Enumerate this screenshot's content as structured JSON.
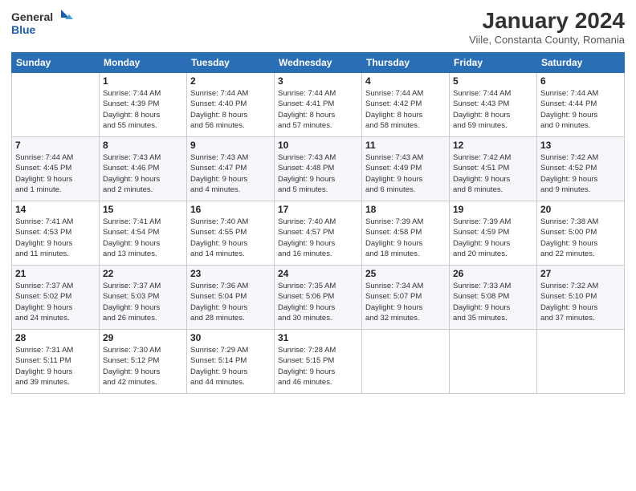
{
  "logo": {
    "general": "General",
    "blue": "Blue"
  },
  "header": {
    "title": "January 2024",
    "location": "Viile, Constanta County, Romania"
  },
  "weekdays": [
    "Sunday",
    "Monday",
    "Tuesday",
    "Wednesday",
    "Thursday",
    "Friday",
    "Saturday"
  ],
  "weeks": [
    [
      {
        "day": "",
        "info": ""
      },
      {
        "day": "1",
        "info": "Sunrise: 7:44 AM\nSunset: 4:39 PM\nDaylight: 8 hours\nand 55 minutes."
      },
      {
        "day": "2",
        "info": "Sunrise: 7:44 AM\nSunset: 4:40 PM\nDaylight: 8 hours\nand 56 minutes."
      },
      {
        "day": "3",
        "info": "Sunrise: 7:44 AM\nSunset: 4:41 PM\nDaylight: 8 hours\nand 57 minutes."
      },
      {
        "day": "4",
        "info": "Sunrise: 7:44 AM\nSunset: 4:42 PM\nDaylight: 8 hours\nand 58 minutes."
      },
      {
        "day": "5",
        "info": "Sunrise: 7:44 AM\nSunset: 4:43 PM\nDaylight: 8 hours\nand 59 minutes."
      },
      {
        "day": "6",
        "info": "Sunrise: 7:44 AM\nSunset: 4:44 PM\nDaylight: 9 hours\nand 0 minutes."
      }
    ],
    [
      {
        "day": "7",
        "info": "Sunrise: 7:44 AM\nSunset: 4:45 PM\nDaylight: 9 hours\nand 1 minute."
      },
      {
        "day": "8",
        "info": "Sunrise: 7:43 AM\nSunset: 4:46 PM\nDaylight: 9 hours\nand 2 minutes."
      },
      {
        "day": "9",
        "info": "Sunrise: 7:43 AM\nSunset: 4:47 PM\nDaylight: 9 hours\nand 4 minutes."
      },
      {
        "day": "10",
        "info": "Sunrise: 7:43 AM\nSunset: 4:48 PM\nDaylight: 9 hours\nand 5 minutes."
      },
      {
        "day": "11",
        "info": "Sunrise: 7:43 AM\nSunset: 4:49 PM\nDaylight: 9 hours\nand 6 minutes."
      },
      {
        "day": "12",
        "info": "Sunrise: 7:42 AM\nSunset: 4:51 PM\nDaylight: 9 hours\nand 8 minutes."
      },
      {
        "day": "13",
        "info": "Sunrise: 7:42 AM\nSunset: 4:52 PM\nDaylight: 9 hours\nand 9 minutes."
      }
    ],
    [
      {
        "day": "14",
        "info": "Sunrise: 7:41 AM\nSunset: 4:53 PM\nDaylight: 9 hours\nand 11 minutes."
      },
      {
        "day": "15",
        "info": "Sunrise: 7:41 AM\nSunset: 4:54 PM\nDaylight: 9 hours\nand 13 minutes."
      },
      {
        "day": "16",
        "info": "Sunrise: 7:40 AM\nSunset: 4:55 PM\nDaylight: 9 hours\nand 14 minutes."
      },
      {
        "day": "17",
        "info": "Sunrise: 7:40 AM\nSunset: 4:57 PM\nDaylight: 9 hours\nand 16 minutes."
      },
      {
        "day": "18",
        "info": "Sunrise: 7:39 AM\nSunset: 4:58 PM\nDaylight: 9 hours\nand 18 minutes."
      },
      {
        "day": "19",
        "info": "Sunrise: 7:39 AM\nSunset: 4:59 PM\nDaylight: 9 hours\nand 20 minutes."
      },
      {
        "day": "20",
        "info": "Sunrise: 7:38 AM\nSunset: 5:00 PM\nDaylight: 9 hours\nand 22 minutes."
      }
    ],
    [
      {
        "day": "21",
        "info": "Sunrise: 7:37 AM\nSunset: 5:02 PM\nDaylight: 9 hours\nand 24 minutes."
      },
      {
        "day": "22",
        "info": "Sunrise: 7:37 AM\nSunset: 5:03 PM\nDaylight: 9 hours\nand 26 minutes."
      },
      {
        "day": "23",
        "info": "Sunrise: 7:36 AM\nSunset: 5:04 PM\nDaylight: 9 hours\nand 28 minutes."
      },
      {
        "day": "24",
        "info": "Sunrise: 7:35 AM\nSunset: 5:06 PM\nDaylight: 9 hours\nand 30 minutes."
      },
      {
        "day": "25",
        "info": "Sunrise: 7:34 AM\nSunset: 5:07 PM\nDaylight: 9 hours\nand 32 minutes."
      },
      {
        "day": "26",
        "info": "Sunrise: 7:33 AM\nSunset: 5:08 PM\nDaylight: 9 hours\nand 35 minutes."
      },
      {
        "day": "27",
        "info": "Sunrise: 7:32 AM\nSunset: 5:10 PM\nDaylight: 9 hours\nand 37 minutes."
      }
    ],
    [
      {
        "day": "28",
        "info": "Sunrise: 7:31 AM\nSunset: 5:11 PM\nDaylight: 9 hours\nand 39 minutes."
      },
      {
        "day": "29",
        "info": "Sunrise: 7:30 AM\nSunset: 5:12 PM\nDaylight: 9 hours\nand 42 minutes."
      },
      {
        "day": "30",
        "info": "Sunrise: 7:29 AM\nSunset: 5:14 PM\nDaylight: 9 hours\nand 44 minutes."
      },
      {
        "day": "31",
        "info": "Sunrise: 7:28 AM\nSunset: 5:15 PM\nDaylight: 9 hours\nand 46 minutes."
      },
      {
        "day": "",
        "info": ""
      },
      {
        "day": "",
        "info": ""
      },
      {
        "day": "",
        "info": ""
      }
    ]
  ]
}
